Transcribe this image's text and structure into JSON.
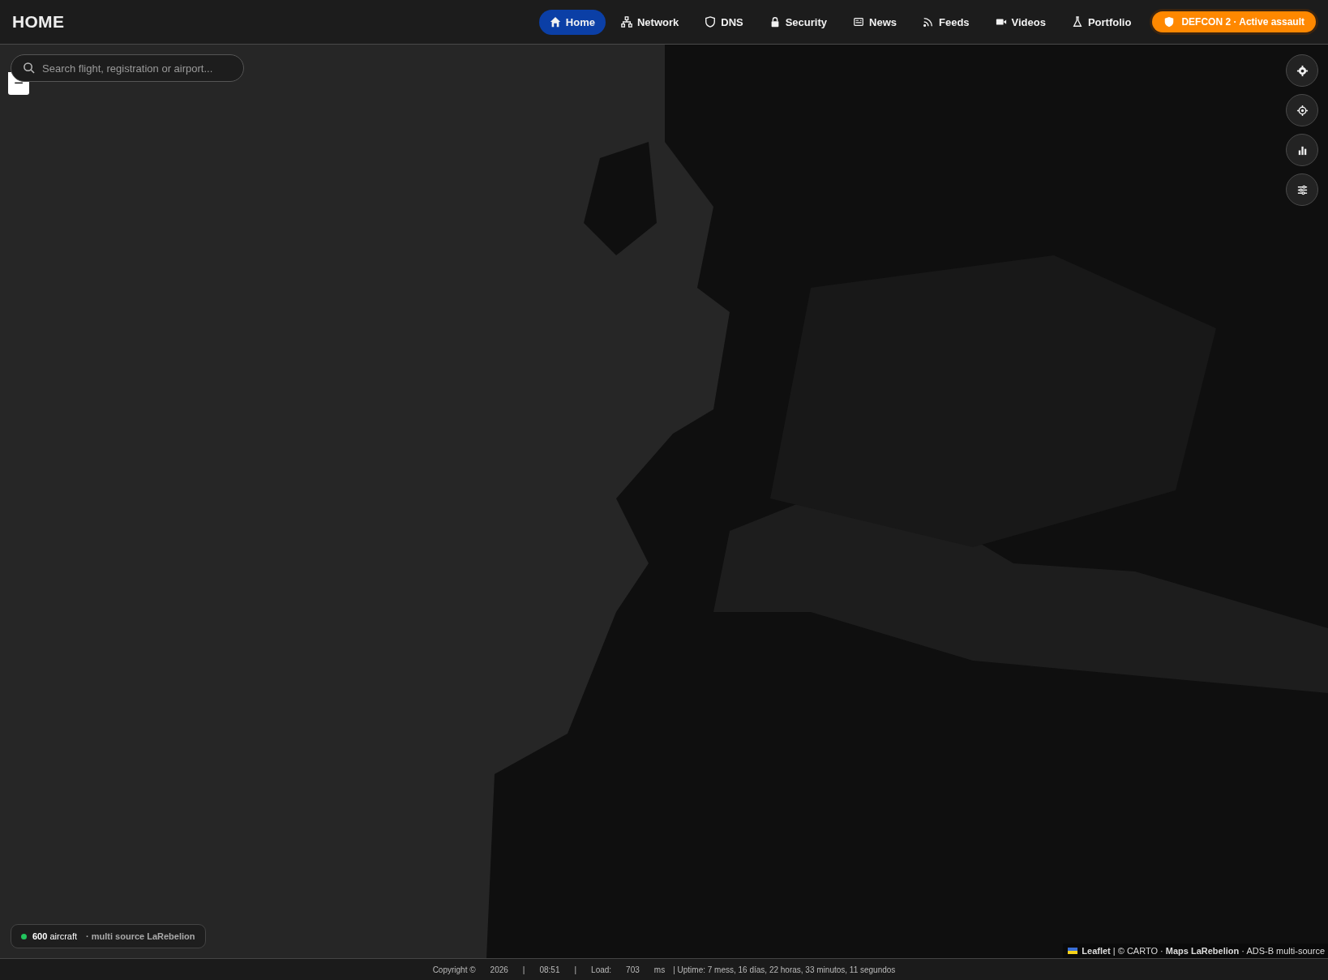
{
  "header": {
    "title": "HOME",
    "nav": [
      {
        "label": "Home",
        "selected": true
      },
      {
        "label": "Network",
        "selected": false
      },
      {
        "label": "DNS",
        "selected": false
      },
      {
        "label": "Security",
        "selected": false
      },
      {
        "label": "News",
        "selected": false
      },
      {
        "label": "Feeds",
        "selected": false
      },
      {
        "label": "Videos",
        "selected": false
      },
      {
        "label": "Portfolio",
        "selected": false
      }
    ],
    "alert": {
      "label": "DEFCON 2 · Active assault"
    }
  },
  "map": {
    "kind": "picture",
    "search": {
      "placeholder": "Search flight, registration or airport..."
    },
    "zoom_out": "−",
    "status": {
      "color": "#22c55e",
      "count": "600",
      "count_label": "aircraft",
      "source": "· multi source LaRebelion"
    },
    "attribution": "**Leaflet** | © CARTO · **Maps LaRebelion** · ADS-B multi-source"
  },
  "footer": {
    "items": [
      "Copyright ©",
      "2026",
      "|",
      "08:51",
      "|",
      "Load:",
      "703",
      "ms",
      "| Uptime: 7 mess, 16 días, 22 horas, 33 minutos, 11 segundos"
    ]
  }
}
